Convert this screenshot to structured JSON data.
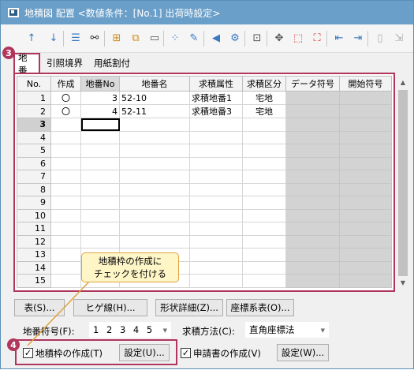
{
  "window": {
    "title": "地積図 配置 <数値条件：[No.1] 出荷時設定>"
  },
  "toolbar": {
    "icons": [
      "arrow-up-icon",
      "arrow-down-icon",
      "list-icon",
      "binoculars-icon",
      "insert-row-icon",
      "copy-row-icon",
      "ruler-icon",
      "points-icon",
      "edit-pen-icon",
      "speaker-icon",
      "speaker-settings-icon",
      "layout-icon",
      "move-point-icon",
      "select-points-icon",
      "select-dashed-icon",
      "align-left-icon",
      "align-right-icon",
      "column-icon",
      "export-icon"
    ]
  },
  "tabs": [
    {
      "label": "地番"
    },
    {
      "label": "引照境界"
    },
    {
      "label": "用紙割付"
    }
  ],
  "grid": {
    "headers": [
      "No.",
      "作成",
      "地番No",
      "地番名",
      "求積属性",
      "求積区分",
      "データ符号",
      "開始符号"
    ],
    "rows": [
      [
        "1",
        "〇",
        "3",
        "52-10",
        "求積地番1",
        "宅地",
        "",
        ""
      ],
      [
        "2",
        "〇",
        "4",
        "52-11",
        "求積地番3",
        "宅地",
        "",
        ""
      ],
      [
        "3",
        "",
        "",
        "",
        "",
        "",
        "",
        ""
      ],
      [
        "4",
        "",
        "",
        "",
        "",
        "",
        "",
        ""
      ],
      [
        "5",
        "",
        "",
        "",
        "",
        "",
        "",
        ""
      ],
      [
        "6",
        "",
        "",
        "",
        "",
        "",
        "",
        ""
      ],
      [
        "7",
        "",
        "",
        "",
        "",
        "",
        "",
        ""
      ],
      [
        "8",
        "",
        "",
        "",
        "",
        "",
        "",
        ""
      ],
      [
        "9",
        "",
        "",
        "",
        "",
        "",
        "",
        ""
      ],
      [
        "10",
        "",
        "",
        "",
        "",
        "",
        "",
        ""
      ],
      [
        "11",
        "",
        "",
        "",
        "",
        "",
        "",
        ""
      ],
      [
        "12",
        "",
        "",
        "",
        "",
        "",
        "",
        ""
      ],
      [
        "13",
        "",
        "",
        "",
        "",
        "",
        "",
        ""
      ],
      [
        "14",
        "",
        "",
        "",
        "",
        "",
        "",
        ""
      ],
      [
        "15",
        "",
        "",
        "",
        "",
        "",
        "",
        ""
      ]
    ],
    "current_row": "3"
  },
  "buttons": {
    "table": "表(S)...",
    "hige": "ヒゲ線(H)...",
    "katachi": "形状詳細(Z)...",
    "zahyo": "座標系表(O)...",
    "frame_settings": "設定(U)...",
    "app_settings": "設定(W)..."
  },
  "form": {
    "chiban_fugo_label": "地番符号(F):",
    "chiban_fugo_value": "1 2 3 4 5",
    "kyuseki_label": "求積方法(C):",
    "kyuseki_value": "直角座標法",
    "frame_checkbox_label": "地積枠の作成(T)",
    "frame_checked": true,
    "application_checkbox_label": "申請書の作成(V)",
    "application_checked": true
  },
  "annotations": {
    "badge3": "3",
    "badge4": "4",
    "callout": "地積枠の作成に チェックを付ける",
    "highlight_color": "#b0365c",
    "callout_bg": "#fff6c8"
  }
}
